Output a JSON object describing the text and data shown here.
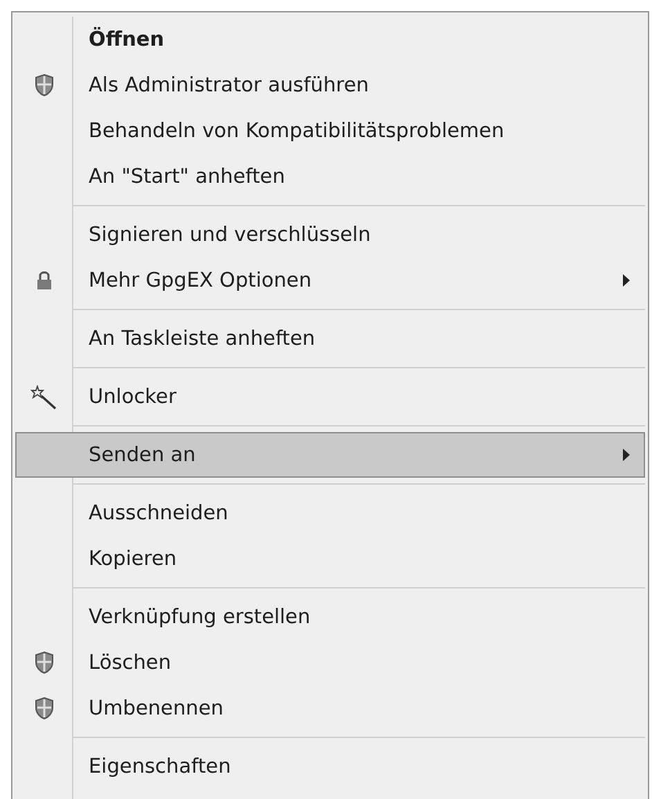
{
  "menu": {
    "entries": [
      {
        "kind": "plain",
        "label": "Öffnen",
        "bold": true,
        "submenu": false,
        "selected": false
      },
      {
        "kind": "shield",
        "label": "Als Administrator ausführen",
        "bold": false,
        "submenu": false,
        "selected": false
      },
      {
        "kind": "plain",
        "label": "Behandeln von Kompatibilitätsproblemen",
        "bold": false,
        "submenu": false,
        "selected": false
      },
      {
        "kind": "plain",
        "label": "An \"Start\" anheften",
        "bold": false,
        "submenu": false,
        "selected": false
      },
      {
        "kind": "separator"
      },
      {
        "kind": "plain",
        "label": "Signieren und verschlüsseln",
        "bold": false,
        "submenu": false,
        "selected": false
      },
      {
        "kind": "lock",
        "label": "Mehr GpgEX Optionen",
        "bold": false,
        "submenu": true,
        "selected": false
      },
      {
        "kind": "separator"
      },
      {
        "kind": "plain",
        "label": "An Taskleiste anheften",
        "bold": false,
        "submenu": false,
        "selected": false
      },
      {
        "kind": "separator"
      },
      {
        "kind": "wand",
        "label": "Unlocker",
        "bold": false,
        "submenu": false,
        "selected": false
      },
      {
        "kind": "separator"
      },
      {
        "kind": "plain",
        "label": "Senden an",
        "bold": false,
        "submenu": true,
        "selected": true
      },
      {
        "kind": "separator"
      },
      {
        "kind": "plain",
        "label": "Ausschneiden",
        "bold": false,
        "submenu": false,
        "selected": false
      },
      {
        "kind": "plain",
        "label": "Kopieren",
        "bold": false,
        "submenu": false,
        "selected": false
      },
      {
        "kind": "separator"
      },
      {
        "kind": "plain",
        "label": "Verknüpfung erstellen",
        "bold": false,
        "submenu": false,
        "selected": false
      },
      {
        "kind": "shield",
        "label": "Löschen",
        "bold": false,
        "submenu": false,
        "selected": false
      },
      {
        "kind": "shield",
        "label": "Umbenennen",
        "bold": false,
        "submenu": false,
        "selected": false
      },
      {
        "kind": "separator"
      },
      {
        "kind": "plain",
        "label": "Eigenschaften",
        "bold": false,
        "submenu": false,
        "selected": false
      }
    ]
  }
}
